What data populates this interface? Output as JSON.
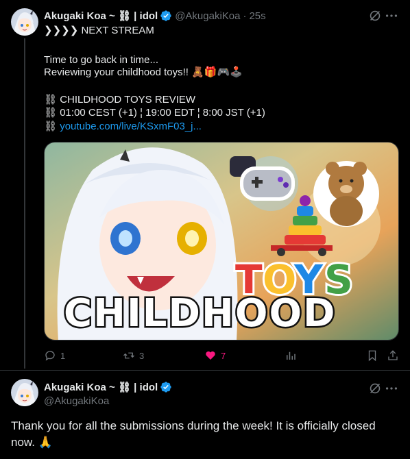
{
  "tweet1": {
    "display_name": "Akugaki Koa ~ ⛓ | idol",
    "handle": "@AkugakiKoa",
    "separator": "·",
    "time": "25s",
    "lines": [
      "❯❯❯❯ NEXT STREAM",
      "Time to go back in time...",
      "Reviewing your childhood toys!! 🧸🎁🎮🕹️",
      "⛓  CHILDHOOD TOYS REVIEW",
      "⛓  01:00 CEST (+1) ¦ 19:00 EDT ¦ 8:00 JST (+1)"
    ],
    "link_prefix": "⛓  ",
    "link_text": "youtube.com/live/KSxmF03_j...",
    "media": {
      "title_small": "TOYS",
      "title_big": "CHILDHOOD",
      "toy_colors": [
        "#e53935",
        "#fbc02d",
        "#43a047",
        "#1e88e5",
        "#8e24aa"
      ]
    },
    "actions": {
      "reply_count": "1",
      "retweet_count": "3",
      "like_count": "7"
    }
  },
  "tweet2": {
    "display_name": "Akugaki Koa ~ ⛓ | idol",
    "handle": "@AkugakiKoa",
    "text": "Thank you for all the submissions during the week! It is officially closed now. 🙏"
  },
  "colors": {
    "background": "#000000",
    "text": "#e7e9ea",
    "muted": "#71767b",
    "link": "#1d9bf0",
    "like": "#f91880",
    "verified": "#1d9bf0"
  }
}
